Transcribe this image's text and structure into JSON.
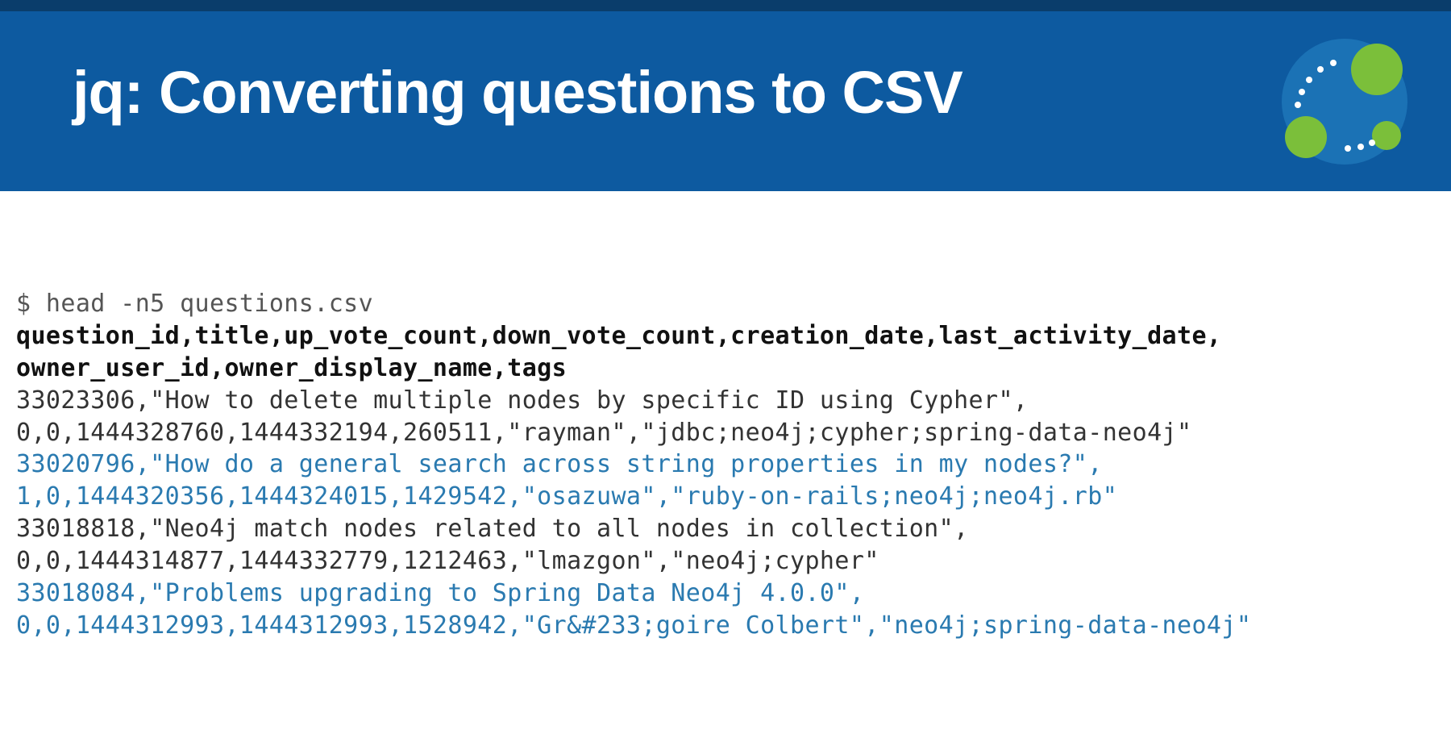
{
  "slide": {
    "title": "jq: Converting questions to CSV"
  },
  "terminal": {
    "command": "$ head -n5 questions.csv",
    "header_line1": "question_id,title,up_vote_count,down_vote_count,creation_date,last_activity_date,",
    "header_line2": "owner_user_id,owner_display_name,tags",
    "rows": [
      {
        "a": "33023306,\"How to delete multiple nodes by specific ID using Cypher\",",
        "b": "0,0,1444328760,1444332194,260511,\"rayman\",\"jdbc;neo4j;cypher;spring-data-neo4j\""
      },
      {
        "a": "33020796,\"How do a general search across string properties in my nodes?\",",
        "b": "1,0,1444320356,1444324015,1429542,\"osazuwa\",\"ruby-on-rails;neo4j;neo4j.rb\""
      },
      {
        "a": "33018818,\"Neo4j match nodes related to all nodes in collection\",",
        "b": "0,0,1444314877,1444332779,1212463,\"lmazgon\",\"neo4j;cypher\""
      },
      {
        "a": "33018084,\"Problems upgrading to Spring Data Neo4j 4.0.0\",",
        "b": "0,0,1444312993,1444312993,1528942,\"Gr&#233;goire Colbert\",\"neo4j;spring-data-neo4j\""
      }
    ]
  }
}
